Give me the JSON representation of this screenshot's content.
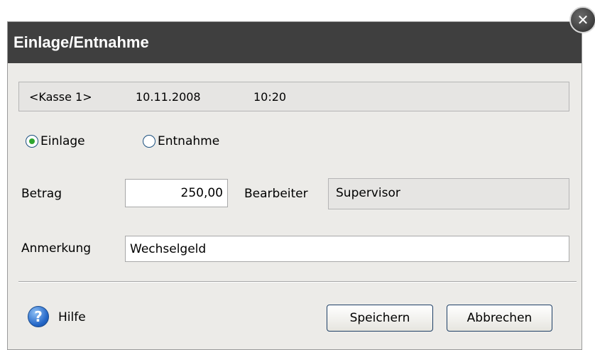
{
  "dialog": {
    "title": "Einlage/Entnahme",
    "close_icon": "close-icon",
    "info": {
      "register": "<Kasse 1>",
      "date": "10.11.2008",
      "time": "10:20"
    },
    "radio_options": [
      {
        "label": "Einlage",
        "selected": true
      },
      {
        "label": "Entnahme",
        "selected": false
      }
    ],
    "fields": {
      "amount_label": "Betrag",
      "amount_value": "250,00",
      "operator_label": "Bearbeiter",
      "operator_value": "Supervisor",
      "note_label": "Anmerkung",
      "note_value": "Wechselgeld"
    },
    "footer": {
      "help_icon": "help-icon",
      "help_label": "Hilfe",
      "save_label": "Speichern",
      "cancel_label": "Abbrechen"
    }
  }
}
